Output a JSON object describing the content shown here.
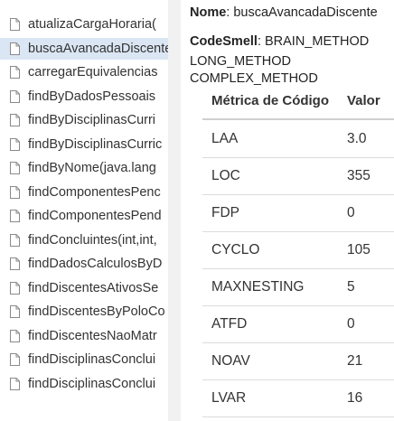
{
  "methods": [
    "atualizaCargaHoraria(",
    "buscaAvancadaDiscente",
    "carregarEquivalencias",
    "findByDadosPessoais",
    "findByDisciplinasCurri",
    "findByDisciplinasCurric",
    "findByNome(java.lang",
    "findComponentesPenc",
    "findComponentesPend",
    "findConcluintes(int,int,",
    "findDadosCalculosByD",
    "findDiscentesAtivosSe",
    "findDiscentesByPoloCo",
    "findDiscentesNaoMatr",
    "findDisciplinasConclui",
    "findDisciplinasConclui"
  ],
  "selected_index": 1,
  "details": {
    "name_label": "Nome",
    "name_value": ": buscaAvancadaDiscente",
    "codesmell_label": "CodeSmell",
    "codesmell_value": ": BRAIN_METHOD",
    "smell_line2": "LONG_METHOD",
    "smell_line3": "COMPLEX_METHOD"
  },
  "metrics_table": {
    "headers": {
      "metric": "Métrica de Código",
      "value": "Valor"
    },
    "rows": [
      {
        "metric": "LAA",
        "value": "3.0"
      },
      {
        "metric": "LOC",
        "value": "355"
      },
      {
        "metric": "FDP",
        "value": "0"
      },
      {
        "metric": "CYCLO",
        "value": "105"
      },
      {
        "metric": "MAXNESTING",
        "value": "5"
      },
      {
        "metric": "ATFD",
        "value": "0"
      },
      {
        "metric": "NOAV",
        "value": "21"
      },
      {
        "metric": "LVAR",
        "value": "16"
      }
    ]
  },
  "colors": {
    "selected_bg": "#dbe6f4",
    "row_border": "#dcdcdc"
  },
  "icons": {
    "method_item": "file-icon"
  }
}
